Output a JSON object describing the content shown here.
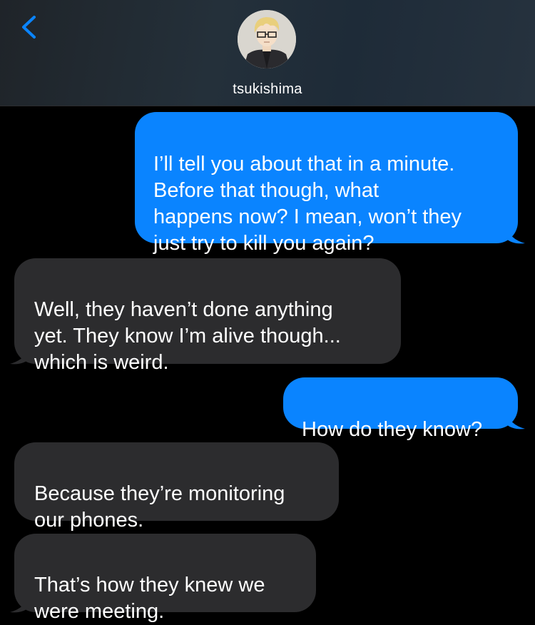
{
  "header": {
    "contact_name": "tsukishima",
    "back_icon": "chevron-left-icon",
    "avatar_icon": "contact-avatar"
  },
  "colors": {
    "sent_bubble": "#0a84ff",
    "received_bubble": "#2c2c2e",
    "accent": "#0a84ff",
    "background": "#000000"
  },
  "messages": [
    {
      "direction": "sent",
      "text": "I’ll tell you about that in a minute.\nBefore that though, what\nhappens now? I mean, won’t they\njust try to kill you again?"
    },
    {
      "direction": "received",
      "text": "Well, they haven’t done anything\nyet. They know I’m alive though...\nwhich is weird."
    },
    {
      "direction": "sent",
      "text": "How do they know?"
    },
    {
      "direction": "received",
      "text": "Because they’re monitoring\nour phones."
    },
    {
      "direction": "received",
      "text": "That’s how they knew we\nwere meeting."
    }
  ]
}
